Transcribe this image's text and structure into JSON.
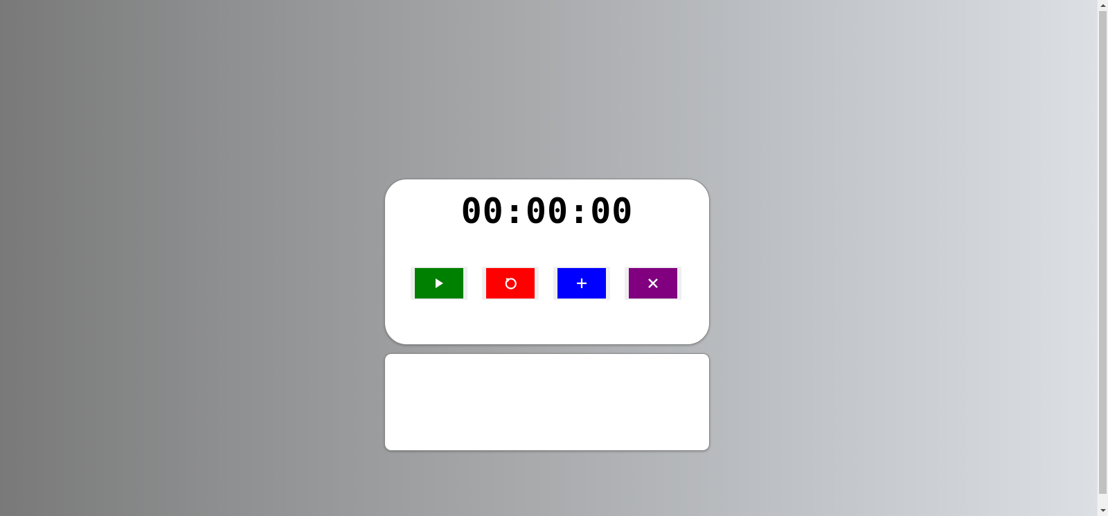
{
  "timer": {
    "display": "00:00:00"
  },
  "controls": [
    {
      "name": "start-button",
      "icon": "play-icon",
      "color": "#008000"
    },
    {
      "name": "reset-button",
      "icon": "reset-icon",
      "color": "#ff0000"
    },
    {
      "name": "add-button",
      "icon": "plus-icon",
      "color": "#0000ff"
    },
    {
      "name": "close-button",
      "icon": "close-icon",
      "color": "#800080"
    }
  ],
  "log": {
    "entries": []
  },
  "theme": {
    "card_background": "#ffffff",
    "page_gradient_start": "#797979",
    "page_gradient_end": "#dde1e6"
  }
}
